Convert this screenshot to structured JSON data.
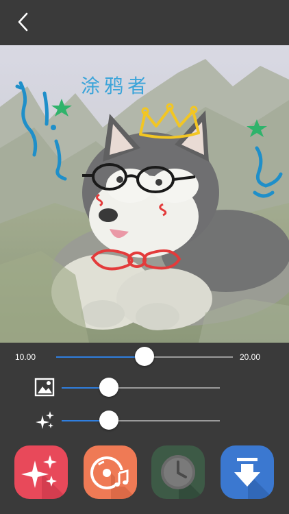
{
  "colors": {
    "accent": "#2f7fe0",
    "background": "#3a3a3a",
    "sparkle_button": "#e8495a",
    "music_button": "#ef7a55",
    "history_button": "#3d5a46",
    "save_button": "#3b78d0"
  },
  "header": {
    "back_icon": "chevron-left-icon"
  },
  "canvas": {
    "doodle_text": "涂鸦者"
  },
  "sliders": {
    "main": {
      "min_label": "10.00",
      "max_label": "20.00",
      "level": 0.5
    },
    "image": {
      "icon": "image-icon",
      "level": 0.3
    },
    "effect": {
      "icon": "sparkles-icon",
      "level": 0.3
    }
  },
  "toolbar": [
    {
      "icon": "sparkles-icon"
    },
    {
      "icon": "music-disc-icon"
    },
    {
      "icon": "clock-icon"
    },
    {
      "icon": "download-icon"
    }
  ]
}
